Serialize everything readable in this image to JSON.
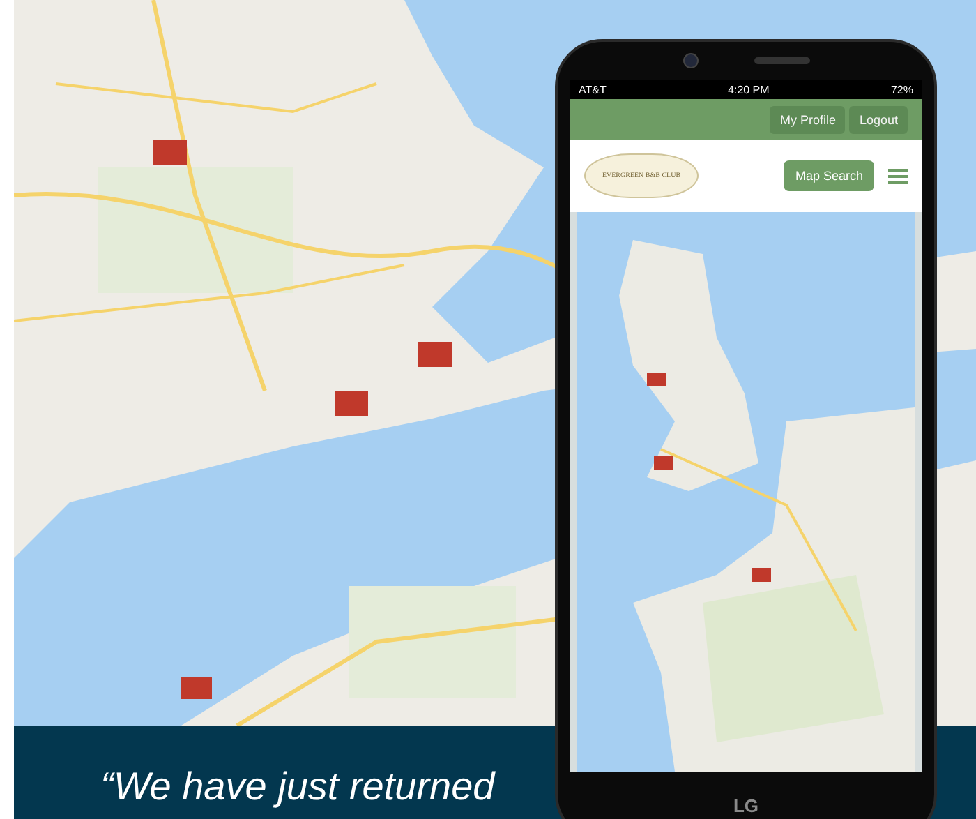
{
  "phone": {
    "status_bar": {
      "carrier": "AT&T",
      "time": "4:20 PM",
      "battery": "72%"
    },
    "header_buttons": [
      "My Profile",
      "Logout"
    ],
    "logo": {
      "text": "EVERGREEN B&B CLUB"
    },
    "nav_button": "Map Search",
    "brand": "LG"
  },
  "testimonial": {
    "quote": "“We have just returned"
  }
}
